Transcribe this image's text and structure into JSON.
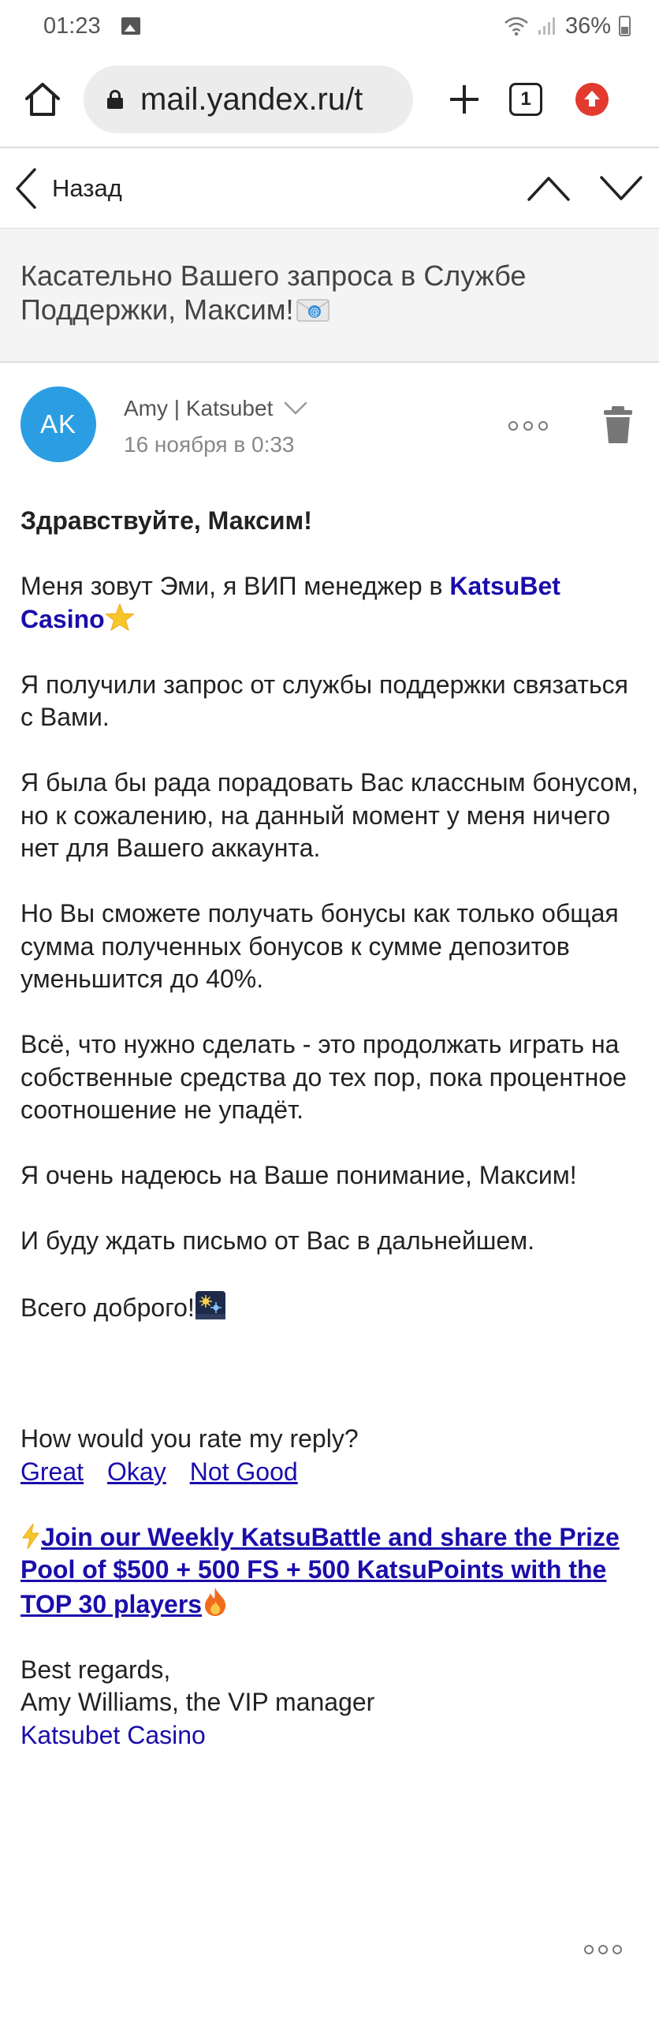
{
  "status_bar": {
    "time": "01:23",
    "battery": "36%"
  },
  "browser": {
    "url": "mail.yandex.ru/t",
    "tab_count": "1"
  },
  "mail_nav": {
    "back_label": "Назад"
  },
  "message": {
    "subject": "Касательно Вашего запроса в Службе Поддержки, Максим!",
    "sender": {
      "initials": "AK",
      "name": "Amy | Katsubet",
      "date": "16 ноября в 0:33"
    },
    "body": {
      "greeting": "Здравствуйте, Максим!",
      "intro_text": "Меня зовут Эми, я ВИП менеджер в ",
      "intro_link": "KatsuBet Casino",
      "p2": "Я получили запрос от службы поддержки связаться с Вами.",
      "p3": "Я была бы рада порадовать Вас классным бонусом, но к сожалению, на данный момент у меня ничего нет для Вашего аккаунта.",
      "p4": "Но Вы сможете получать бонусы как только общая сумма полученных бонусов к сумме депозитов уменьшится до 40%.",
      "p5": "Всё, что нужно сделать - это продолжать играть на собственные средства до тех пор, пока процентное соотношение не упадёт.",
      "p6": "Я очень надеюсь на Ваше понимание, Максим!",
      "p7": "И буду ждать письмо от Вас в дальнейшем.",
      "p8": "Всего доброго!",
      "rate_question": "How would you rate my reply?",
      "rate_great": "Great",
      "rate_okay": "Okay",
      "rate_not_good": "Not Good",
      "promo_link": "Join our Weekly KatsuBattle and share the Prize Pool of $500 + 500 FS + 500 KatsuPoints with the TOP 30 players",
      "sign_regards": "Best regards,",
      "sign_name": "Amy Williams, the VIP manager",
      "sign_link": "Katsubet Casino"
    }
  },
  "colors": {
    "avatar": "#2b9ee3",
    "link": "#1a0dab",
    "great": "#52a833",
    "not_good": "#d42020",
    "update_badge": "#e23a2e"
  }
}
